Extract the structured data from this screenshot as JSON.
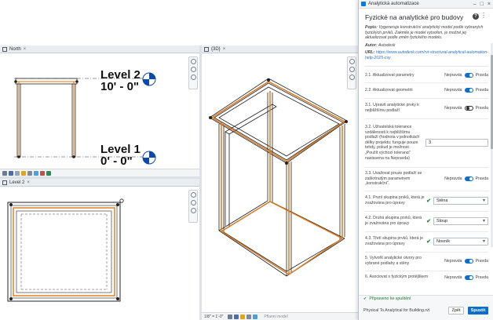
{
  "views": {
    "north": {
      "tab_label": "North"
    },
    "level2": {
      "tab_label": "Level 2"
    },
    "view3d": {
      "tab_label": "{3D}",
      "scale": "1/8\" = 1'-0\"",
      "mode": "Pflanni model"
    }
  },
  "levels": [
    {
      "name": "Level 2",
      "elevation": "10' - 0\""
    },
    {
      "name": "Level 1",
      "elevation": "0' - 0\""
    }
  ],
  "panel": {
    "window_title": "Analytická automatizace",
    "heading": "Fyzické na analytické pro budovy",
    "description_label": "Popis:",
    "description": "Vygeneruje konstrukční analytický model podle vybraných fyzických prvků. Zakmile je model vytvořen, je možné jej aktualizovat podle změn fyzického modelu.",
    "author_label": "Autor:",
    "author": "Autodesk",
    "url_label": "URL:",
    "url": "https://www.autodesk.com/rvt-structural-analytical-automation-help-2025-csy",
    "false_label": "Nepravda",
    "true_label": "Pravda",
    "items": [
      {
        "label": "2.1. Aktualizovat parametry",
        "state": "on"
      },
      {
        "label": "2.2. Aktualizovat geometrii",
        "state": "on"
      },
      {
        "label": "3.1. Upravit analytické prvky k nejbližšímu podlaží",
        "state": "off"
      },
      {
        "label": "3.2. Uživatelská tolerance vzdálenosti k nejbližšímu podlaží (hodnota v jednotkách délky projektu; funguje pouze tehdy, pokud je možnost „Použít výchozí toleranci“ nastavena na Nepravda)",
        "value": "3"
      },
      {
        "label": "3.3. Uvažovat pouze podlaží se zaškrtnutým parametrem „konstrukční“.",
        "state": "on"
      },
      {
        "label": "4.1. První skupina prvků, která je zvažována pro úpravy",
        "select": "Stěna"
      },
      {
        "label": "4.2. Druhá skupina prvků, která je zvažována pro úpravy",
        "select": "Sloup"
      },
      {
        "label": "4.3. Třetí skupina prvků, která je zvažována pro úpravy",
        "select": "Nosník"
      },
      {
        "label": "5. Vytvořit analytické otvory pro vybrané podlahy a stěny",
        "state": "on"
      },
      {
        "label": "6. Asociovat s fyzickým protějškem",
        "state": "on"
      }
    ],
    "status": "Připraveno ke spuštění",
    "footer_file": "Physical To Analytical for Building.rvt",
    "back_label": "Zpět",
    "run_label": "Spustit"
  }
}
